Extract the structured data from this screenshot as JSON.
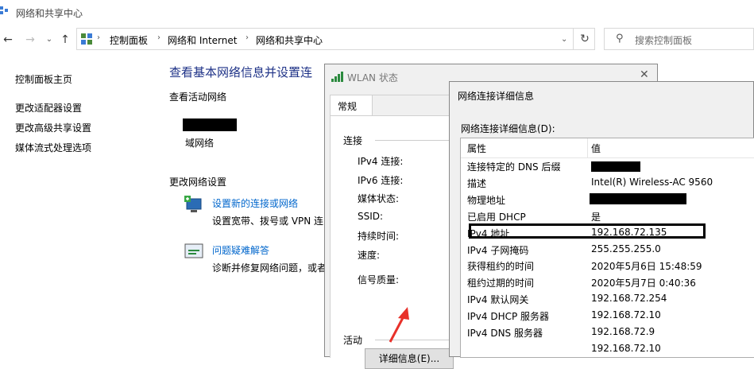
{
  "window": {
    "title": "网络和共享中心"
  },
  "nav": {
    "back_icon": "back-arrow-icon",
    "forward_icon": "forward-arrow-icon",
    "up_icon": "up-arrow-icon",
    "breadcrumbs": [
      "控制面板",
      "网络和 Internet",
      "网络和共享中心"
    ],
    "search_placeholder": "搜索控制面板"
  },
  "left_pane": {
    "items": [
      "控制面板主页",
      "更改适配器设置",
      "更改高级共享设置",
      "媒体流式处理选项"
    ]
  },
  "main": {
    "heading": "查看基本网络信息并设置连",
    "active_network_label": "查看活动网络",
    "network_type": "域网络",
    "change_settings_label": "更改网络设置",
    "tasks": [
      {
        "link": "设置新的连接或网络",
        "desc": "设置宽带、拨号或 VPN 连"
      },
      {
        "link": "问题疑难解答",
        "desc": "诊断并修复网络问题，或者"
      }
    ]
  },
  "wlan_dialog": {
    "title": "WLAN 状态",
    "tab": "常规",
    "section_connection": "连接",
    "fields": [
      "IPv4 连接:",
      "IPv6 连接:",
      "媒体状态:",
      "SSID:",
      "持续时间:",
      "速度:"
    ],
    "signal_label": "信号质量:",
    "details_button": "详细信息(E)...",
    "section_activity": "活动"
  },
  "details_dialog": {
    "title": "网络连接详细信息",
    "list_label": "网络连接详细信息(D):",
    "columns": [
      "属性",
      "值"
    ],
    "rows": [
      {
        "key": "连接特定的 DNS 后缀",
        "value": ""
      },
      {
        "key": "描述",
        "value": "Intel(R) Wireless-AC 9560"
      },
      {
        "key": "物理地址",
        "value": ""
      },
      {
        "key": "已启用 DHCP",
        "value": "是"
      },
      {
        "key": "IPv4 地址",
        "value": "192.168.72.135"
      },
      {
        "key": "IPv4 子网掩码",
        "value": "255.255.255.0"
      },
      {
        "key": "获得租约的时间",
        "value": "2020年5月6日 15:48:59"
      },
      {
        "key": "租约过期的时间",
        "value": "2020年5月7日 0:40:36"
      },
      {
        "key": "IPv4 默认网关",
        "value": "192.168.72.254"
      },
      {
        "key": "IPv4 DHCP 服务器",
        "value": "192.168.72.10"
      },
      {
        "key": "IPv4 DNS 服务器",
        "value": "192.168.72.9"
      },
      {
        "key": "",
        "value": "192.168.72.10"
      }
    ]
  },
  "colors": {
    "link": "#0066cc",
    "heading": "#1e3287",
    "annotation_arrow": "#e8312a"
  }
}
